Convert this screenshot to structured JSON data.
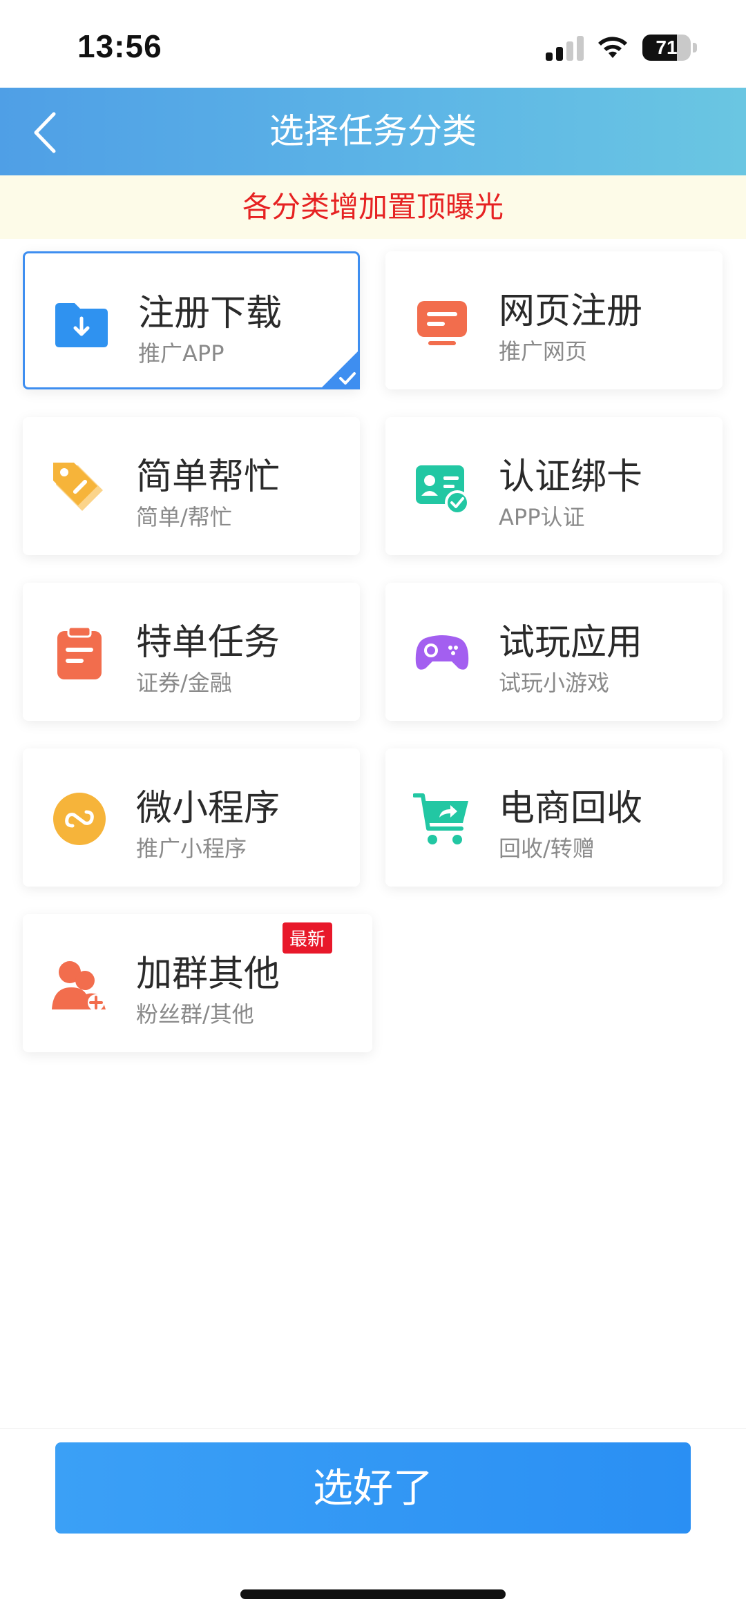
{
  "status_bar": {
    "time": "13:56",
    "battery": "71",
    "battery_level": 0.71
  },
  "header": {
    "title": "选择任务分类"
  },
  "notice": {
    "text": "各分类增加置顶曝光"
  },
  "categories": [
    {
      "title": "注册下载",
      "subtitle": "推广APP",
      "icon": "folder-download-icon",
      "color": "#2f92f0",
      "selected": true
    },
    {
      "title": "网页注册",
      "subtitle": "推广网页",
      "icon": "monitor-icon",
      "color": "#f26d4d",
      "selected": false
    },
    {
      "title": "简单帮忙",
      "subtitle": "简单/帮忙",
      "icon": "tag-icon",
      "color": "#f6b43a",
      "selected": false
    },
    {
      "title": "认证绑卡",
      "subtitle": "APP认证",
      "icon": "id-card-check-icon",
      "color": "#22c7a3",
      "selected": false
    },
    {
      "title": "特单任务",
      "subtitle": "证券/金融",
      "icon": "clipboard-icon",
      "color": "#f26d4d",
      "selected": false
    },
    {
      "title": "试玩应用",
      "subtitle": "试玩小游戏",
      "icon": "gamepad-icon",
      "color": "#a35ff0",
      "selected": false
    },
    {
      "title": "微小程序",
      "subtitle": "推广小程序",
      "icon": "mini-program-icon",
      "color": "#f6b43a",
      "selected": false
    },
    {
      "title": "电商回收",
      "subtitle": "回收/转赠",
      "icon": "cart-share-icon",
      "color": "#22c7a3",
      "selected": false
    },
    {
      "title": "加群其他",
      "subtitle": "粉丝群/其他",
      "icon": "add-user-icon",
      "color": "#f26d4d",
      "selected": false,
      "badge": "最新"
    }
  ],
  "confirm_button": {
    "label": "选好了"
  }
}
